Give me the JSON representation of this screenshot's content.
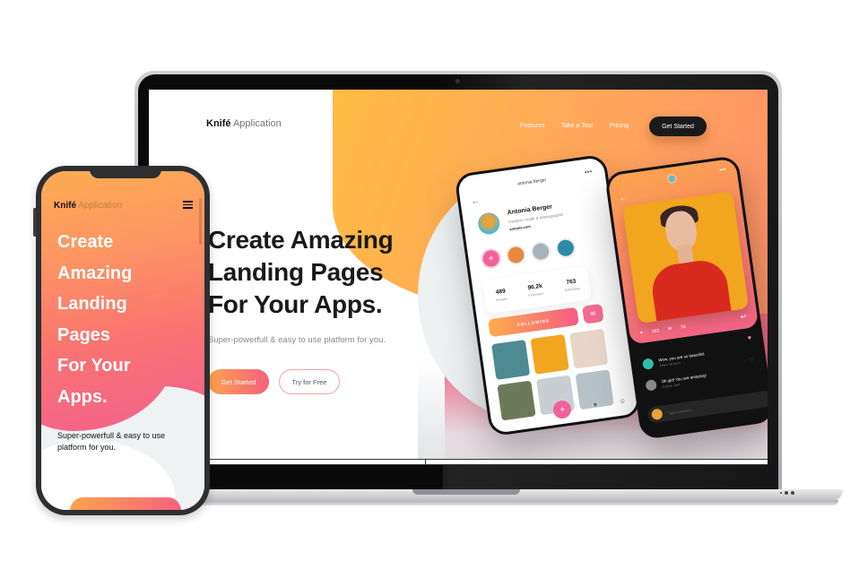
{
  "laptop": {
    "brand_bold": "Knifé",
    "brand_light": " Application",
    "nav": [
      {
        "label": "Features"
      },
      {
        "label": "Take a Tour"
      },
      {
        "label": "Pricing"
      }
    ],
    "cta_label": "Get Started",
    "hero_lines": [
      "Create Amazing",
      "Landing Pages",
      "For Your Apps."
    ],
    "subtitle": "Super-powerfull & easy to use platform for you.",
    "primary_button": "Get Started",
    "secondary_button": "Try for Free",
    "colors": {
      "accent_start": "#fda34d",
      "accent_end": "#f5617e",
      "dark": "#1a1a1a"
    }
  },
  "profile_mockup": {
    "header_username": "antonia.berger",
    "name": "Antonia Berger",
    "description": "Fashion model & photographer",
    "link": "antonia.com",
    "stats": [
      {
        "value": "489",
        "label": "Images"
      },
      {
        "value": "96.2k",
        "label": "Followers"
      },
      {
        "value": "763",
        "label": "Following"
      }
    ],
    "follow_label": "FOLLOWING",
    "grid_colors": [
      "#4e8a94",
      "#f2a51e",
      "#e8d6c8",
      "#6c7a5a",
      "#c9ced2",
      "#b7c2c8"
    ]
  },
  "post_mockup": {
    "likes": "163",
    "comments_count": "78",
    "comments": [
      {
        "text": "Wow, you are so beautiful",
        "author": "Julien M Iano"
      },
      {
        "text": "Oh girl! You are amazing!",
        "author": "Celine Joel"
      }
    ],
    "input_placeholder": "Type comment..."
  },
  "phone": {
    "brand_bold": "Knifé",
    "brand_light": " Application",
    "hero": "Create\nAmazing\nLanding\nPages\nFor Your\nApps.",
    "subtitle": "Super-powerfull & easy to use platform for you."
  },
  "icons": {
    "back": "←",
    "more": "•••",
    "plus": "+",
    "heart": "♥",
    "message": "✉",
    "home": "⌂",
    "search": "⌕",
    "reply": "↩",
    "send": "➤"
  }
}
